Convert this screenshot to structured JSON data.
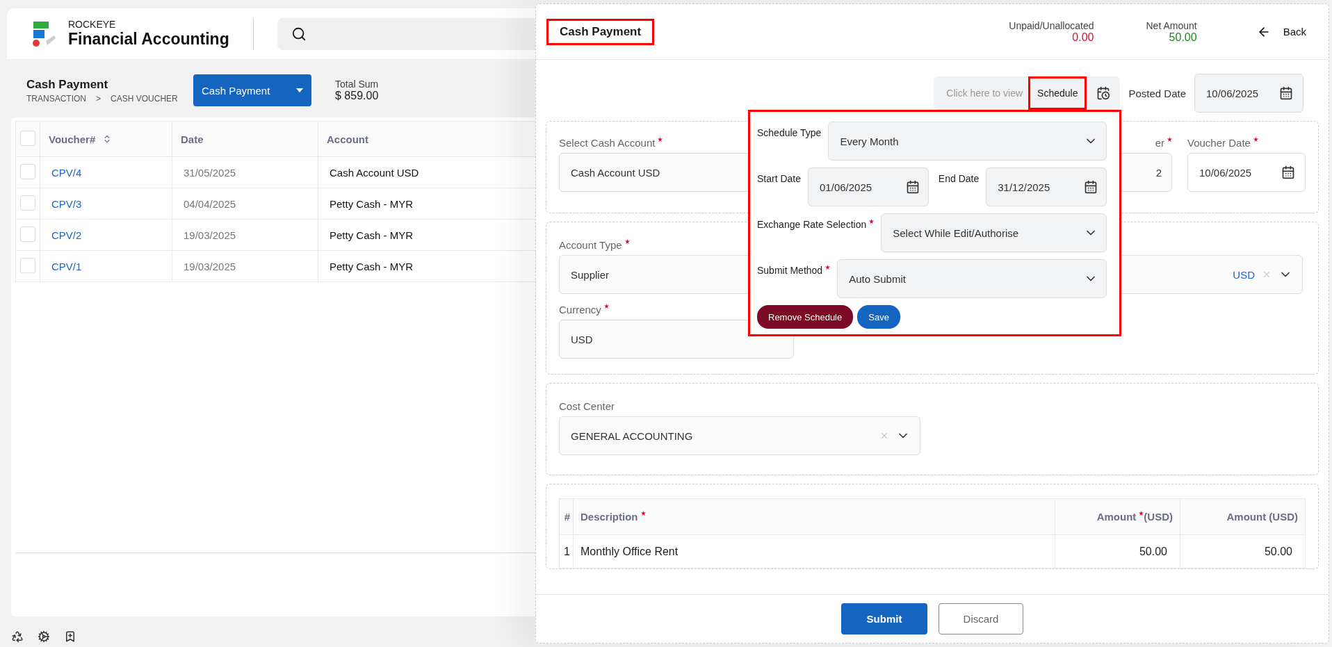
{
  "app": {
    "brand": "ROCKEYE",
    "title": "Financial Accounting"
  },
  "page": {
    "title": "Cash Payment",
    "breadcrumb": [
      "TRANSACTION",
      ">",
      "CASH VOUCHER"
    ],
    "type_button": "Cash Payment",
    "total_label": "Total Sum",
    "total_value": "$ 859.00"
  },
  "table": {
    "all_checked": false,
    "columns": [
      {
        "label": "Voucher#",
        "sortable": true
      },
      {
        "label": "Date",
        "sortable": false
      },
      {
        "label": "Account",
        "sortable": false
      }
    ],
    "rows": [
      {
        "checked": false,
        "cells": [
          "CPV/4",
          "31/05/2025",
          "Cash Account USD"
        ]
      },
      {
        "checked": false,
        "cells": [
          "CPV/3",
          "04/04/2025",
          "Petty Cash - MYR"
        ]
      },
      {
        "checked": false,
        "cells": [
          "CPV/2",
          "19/03/2025",
          "Petty Cash - MYR"
        ]
      },
      {
        "checked": false,
        "cells": [
          "CPV/1",
          "19/03/2025",
          "Petty Cash - MYR"
        ]
      }
    ]
  },
  "drawer": {
    "title": "Cash Payment",
    "highlighted": true,
    "unpaid": {
      "label": "Unpaid/Unallocated",
      "value": "0.00"
    },
    "net": {
      "label": "Net Amount",
      "value": "50.00"
    },
    "back": "Back",
    "schedule_hint": "Click here to view",
    "schedule_button": "Schedule",
    "schedule_highlighted": true,
    "posted_label": "Posted Date",
    "posted_value": "10/06/2025",
    "cash_account": {
      "label": "Select Cash Account",
      "required": true,
      "value": "Cash Account USD"
    },
    "partial_field": {
      "label": "er",
      "required": true,
      "value": "2"
    },
    "voucher_date": {
      "label": "Voucher Date",
      "required": true,
      "value": "10/06/2025"
    },
    "account_type": {
      "label": "Account Type",
      "required": true,
      "value": "Supplier"
    },
    "party_field": {
      "value": "USD"
    },
    "currency": {
      "label": "Currency",
      "required": true,
      "value": "USD"
    },
    "cost_center": {
      "label": "Cost Center",
      "required": false,
      "value": "GENERAL ACCOUNTING"
    },
    "lines": {
      "columns": [
        {
          "label": "#",
          "required": false
        },
        {
          "label": "Description",
          "required": true
        },
        {
          "label": "Amount",
          "required": true,
          "suffix": "(USD)"
        },
        {
          "label": "Amount (USD)",
          "required": false
        }
      ],
      "rows": [
        [
          "1",
          "Monthly Office Rent",
          "50.00",
          "50.00"
        ]
      ]
    },
    "submit": "Submit",
    "discard": "Discard"
  },
  "schedule_popup": {
    "highlighted": true,
    "schedule_type": {
      "label": "Schedule Type",
      "required": false,
      "value": "Every Month"
    },
    "start_date": {
      "label": "Start Date",
      "value": "01/06/2025"
    },
    "end_date": {
      "label": "End Date",
      "value": "31/12/2025"
    },
    "exchange": {
      "label": "Exchange Rate Selection",
      "required": true,
      "value": "Select While Edit/Authorise"
    },
    "submit_method": {
      "label": "Submit Method",
      "required": true,
      "value": "Auto Submit"
    },
    "remove": "Remove Schedule",
    "save": "Save"
  }
}
